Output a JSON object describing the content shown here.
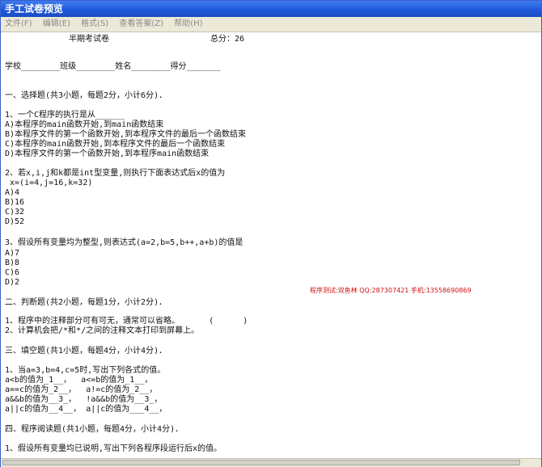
{
  "window": {
    "title": "手工试卷预览"
  },
  "menu": [
    "文件(F)",
    "编辑(E)",
    "格式(S)",
    "查看答案(Z)",
    "帮助(H)"
  ],
  "paper": {
    "title": "半期考试卷",
    "total": "总分：26",
    "info_line": "学校________班级________姓名________得分_______",
    "watermark": "程序测试:双鱼林 QQ:287307421 手机:13558690869",
    "lines": [
      "一、选择题(共3小题，每题2分，小计6分)．",
      "1、一个C程序的执行是从______",
      "A)本程序的main函数开始,到main函数结束",
      "B)本程序文件的第一个函数开始,到本程序文件的最后一个函数结束",
      "C)本程序的main函数开始,到本程序文件的最后一个函数结束",
      "D)本程序文件的第一个函数开始,到本程序main函数结束",
      "2、若x,i,j和k都是int型变量,则执行下面表达式后x的值为",
      " x=(i=4,j=16,k=32)",
      "A)4",
      "B)16",
      "C)32",
      "D)52",
      "3、假设所有变量均为整型,则表达式(a=2,b=5,b++,a+b)的值是",
      "A)7",
      "B)8",
      "C)6",
      "D)2",
      "二、判断题(共2小题，每题1分，小计2分)．",
      "1、程序中的注释部分可有可无，通常可以省略。      (      )",
      "2、计算机会把/*和*/之间的注释文本打印到屏幕上。",
      "三、填空题(共1小题，每题4分，小计4分)．",
      "1、当a=3,b=4,c=5时,写出下列各式的值。",
      "a<b的值为_1__，  a<=b的值为_1__，",
      "a==c的值为_2__，  a!=c的值为_2__，",
      "a&&b的值为__3_，  !a&&b的值为__3_，",
      "a||c的值为__4__， a||c的值为___4__，",
      "四、程序阅读题(共1小题，每题4分，小计4分)．",
      "1、假设所有变量均已说明,写出下列各程序段运行后x的值。"
    ]
  }
}
